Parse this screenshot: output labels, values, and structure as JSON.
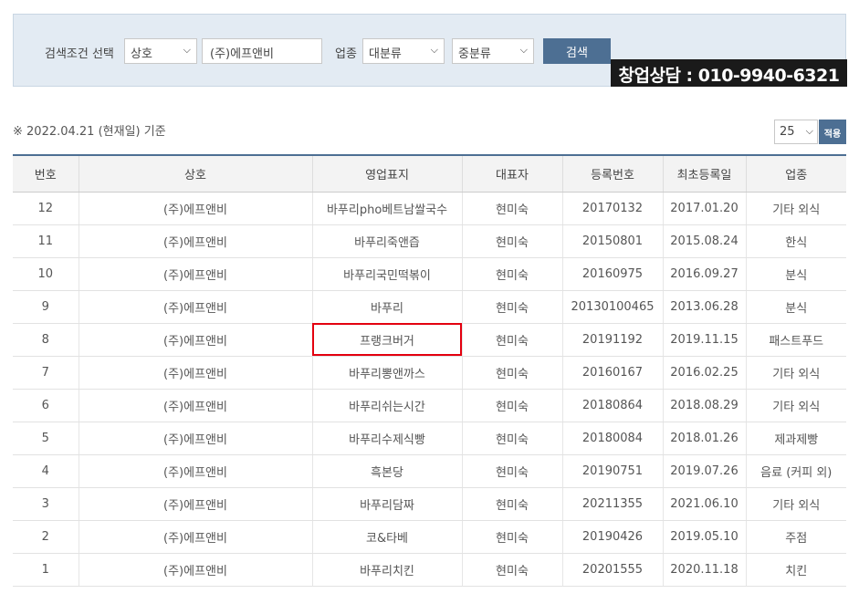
{
  "search": {
    "condition_label": "검색조건 선택",
    "condition_select": "상호",
    "keyword_value": "(주)에프앤비",
    "industry_label": "업종",
    "major_category": "대분류",
    "minor_category": "중분류",
    "search_button": "검색",
    "promo_text": "창업상담 : 010-9940-6321"
  },
  "list": {
    "base_note": "※ 2022.04.21 (현재일) 기준",
    "per_page": "25",
    "apply_button": "적용"
  },
  "table": {
    "columns": [
      "번호",
      "상호",
      "영업표지",
      "대표자",
      "등록번호",
      "최초등록일",
      "업종"
    ],
    "rows": [
      [
        "12",
        "(주)에프앤비",
        "바푸리pho베트남쌀국수",
        "현미숙",
        "20170132",
        "2017.01.20",
        "기타 외식"
      ],
      [
        "11",
        "(주)에프앤비",
        "바푸리죽앤즙",
        "현미숙",
        "20150801",
        "2015.08.24",
        "한식"
      ],
      [
        "10",
        "(주)에프앤비",
        "바푸리국민떡볶이",
        "현미숙",
        "20160975",
        "2016.09.27",
        "분식"
      ],
      [
        "9",
        "(주)에프앤비",
        "바푸리",
        "현미숙",
        "20130100465",
        "2013.06.28",
        "분식"
      ],
      [
        "8",
        "(주)에프앤비",
        "프랭크버거",
        "현미숙",
        "20191192",
        "2019.11.15",
        "패스트푸드"
      ],
      [
        "7",
        "(주)에프앤비",
        "바푸리뽕앤까스",
        "현미숙",
        "20160167",
        "2016.02.25",
        "기타 외식"
      ],
      [
        "6",
        "(주)에프앤비",
        "바푸리쉬는시간",
        "현미숙",
        "20180864",
        "2018.08.29",
        "기타 외식"
      ],
      [
        "5",
        "(주)에프앤비",
        "바푸리수제식빵",
        "현미숙",
        "20180084",
        "2018.01.26",
        "제과제빵"
      ],
      [
        "4",
        "(주)에프앤비",
        "흑본당",
        "현미숙",
        "20190751",
        "2019.07.26",
        "음료 (커피 외)"
      ],
      [
        "3",
        "(주)에프앤비",
        "바푸리담짜",
        "현미숙",
        "20211355",
        "2021.06.10",
        "기타 외식"
      ],
      [
        "2",
        "(주)에프앤비",
        "코&타베",
        "현미숙",
        "20190426",
        "2019.05.10",
        "주점"
      ],
      [
        "1",
        "(주)에프앤비",
        "바푸리치킨",
        "현미숙",
        "20201555",
        "2020.11.18",
        "치킨"
      ]
    ],
    "highlighted_row": 4
  },
  "colors": {
    "panel_bg": "#e3ebf3",
    "button": "#4d6f93",
    "highlight": "#e3000f"
  }
}
